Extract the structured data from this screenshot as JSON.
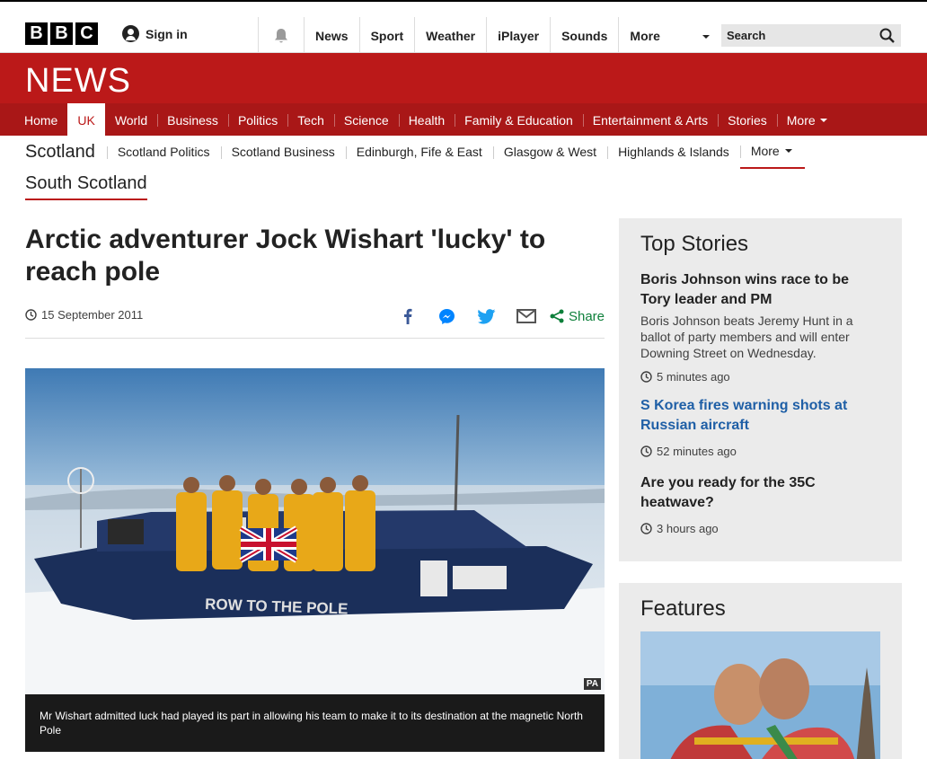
{
  "masthead": {
    "logo_letters": [
      "B",
      "B",
      "C"
    ],
    "signin_label": "Sign in",
    "nav": [
      "News",
      "Sport",
      "Weather",
      "iPlayer",
      "Sounds"
    ],
    "more_label": "More",
    "search_placeholder": "Search"
  },
  "news_band": {
    "wordmark": "NEWS"
  },
  "main_nav": {
    "items": [
      "Home",
      "UK",
      "World",
      "Business",
      "Politics",
      "Tech",
      "Science",
      "Health",
      "Family & Education",
      "Entertainment & Arts",
      "Stories"
    ],
    "active": "UK",
    "more_label": "More"
  },
  "sub_nav": {
    "section": "Scotland",
    "items": [
      "Scotland Politics",
      "Scotland Business",
      "Edinburgh, Fife & East",
      "Glasgow & West",
      "Highlands & Islands"
    ],
    "more_label": "More",
    "subsection": "South Scotland"
  },
  "article": {
    "headline": "Arctic adventurer Jock Wishart 'lucky' to reach pole",
    "date": "15 September 2011",
    "share_label": "Share",
    "photo_credit": "PA",
    "boat_text": "ROW TO THE POLE",
    "caption": "Mr Wishart admitted luck had played its part in allowing his team to make it to its destination at the magnetic North Pole"
  },
  "top_stories": {
    "heading": "Top Stories",
    "stories": [
      {
        "title": "Boris Johnson wins race to be Tory leader and PM",
        "summary": "Boris Johnson beats Jeremy Hunt in a ballot of party members and will enter Downing Street on Wednesday.",
        "time": "5 minutes ago"
      },
      {
        "title": "S Korea fires warning shots at Russian aircraft",
        "summary": "",
        "time": "52 minutes ago"
      },
      {
        "title": "Are you ready for the 35C heatwave?",
        "summary": "",
        "time": "3 hours ago"
      }
    ]
  },
  "features": {
    "heading": "Features"
  },
  "colors": {
    "bbc_red": "#bb1919",
    "nav_red": "#a91717",
    "share_green": "#0d7f3a",
    "link_blue": "#1f5fa6",
    "sidebar_grey": "#ebebeb"
  },
  "icons": {
    "bell": "bell-icon",
    "search": "search-icon",
    "facebook": "facebook-icon",
    "messenger": "messenger-icon",
    "twitter": "twitter-icon",
    "email": "email-icon",
    "share": "share-icon",
    "clock": "clock-icon"
  }
}
